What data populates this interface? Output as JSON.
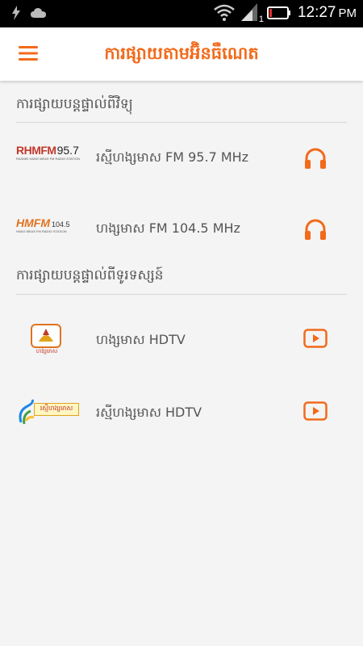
{
  "status_bar": {
    "network_badge": "1",
    "time": "12:27",
    "ampm": "PM"
  },
  "app_bar": {
    "title": "ការផ្សាយតាមអ៊ិនធឺណេត"
  },
  "sections": [
    {
      "header": "ការផ្សាយបន្តផ្ទាល់ពីវិទ្យុ",
      "items": [
        {
          "label": "រស្មីហង្សមាស FM 95.7 MHz",
          "logo_text": "RHMFM",
          "logo_freq": "95.7",
          "logo_sub": "RASMEI HANG MEAS FM RADIO STATION",
          "action_icon": "headphones-icon"
        },
        {
          "label": "ហង្សមាស FM 104.5 MHz",
          "logo_text": "HMFM",
          "logo_freq": "104.5",
          "logo_sub": "HANG MEAS FM RADIO STATION",
          "action_icon": "headphones-icon"
        }
      ]
    },
    {
      "header": "ការផ្សាយបន្តផ្ទាល់ពីទូរទស្សន៍",
      "items": [
        {
          "label": "ហង្សមាស HDTV",
          "logo_caption": "ហង្សមាស",
          "action_icon": "play-icon"
        },
        {
          "label": "រស្មីហង្សមាស HDTV",
          "logo_caption": "រស្មីហង្សមាស",
          "action_icon": "play-icon"
        }
      ]
    }
  ],
  "colors": {
    "accent": "#f26a1b",
    "status_bar": "#000000",
    "background": "#f4f4f4"
  }
}
